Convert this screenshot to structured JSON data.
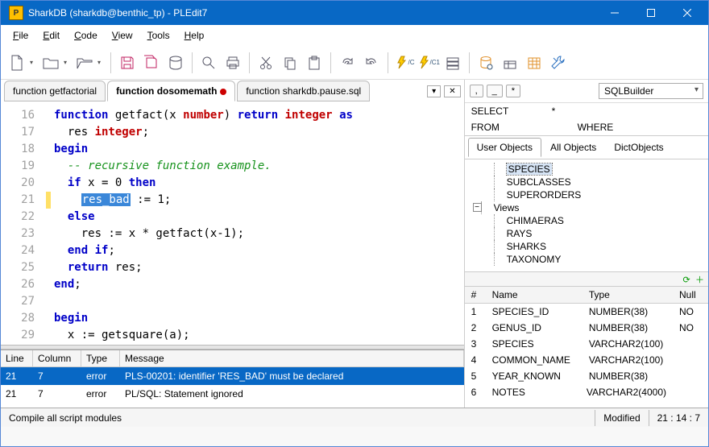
{
  "window": {
    "title": "SharkDB (sharkdb@benthic_tp) - PLEdit7"
  },
  "menu": {
    "file": "File",
    "edit": "Edit",
    "code": "Code",
    "view": "View",
    "tools": "Tools",
    "help": "Help"
  },
  "tabs": [
    {
      "label": "function getfactorial",
      "active": false
    },
    {
      "label": "function dosomemath",
      "active": true,
      "dirty": true
    },
    {
      "label": "function sharkdb.pause.sql",
      "active": false
    }
  ],
  "code_lines": [
    {
      "n": 16,
      "tokens": [
        [
          "kw",
          "function"
        ],
        [
          "id",
          " getfact(x "
        ],
        [
          "dt",
          "number"
        ],
        [
          "id",
          ") "
        ],
        [
          "kw",
          "return"
        ],
        [
          "id",
          " "
        ],
        [
          "dt",
          "integer"
        ],
        [
          "id",
          " "
        ],
        [
          "kw",
          "as"
        ]
      ]
    },
    {
      "n": 17,
      "tokens": [
        [
          "id",
          "  res "
        ],
        [
          "dt",
          "integer"
        ],
        [
          "id",
          ";"
        ]
      ]
    },
    {
      "n": 18,
      "tokens": [
        [
          "kw",
          "begin"
        ]
      ]
    },
    {
      "n": 19,
      "tokens": [
        [
          "id",
          "  "
        ],
        [
          "cm",
          "-- recursive function example."
        ]
      ]
    },
    {
      "n": 20,
      "tokens": [
        [
          "id",
          "  "
        ],
        [
          "kw",
          "if"
        ],
        [
          "id",
          " x = 0 "
        ],
        [
          "kw",
          "then"
        ]
      ]
    },
    {
      "n": 21,
      "err": true,
      "tokens": [
        [
          "id",
          "    "
        ],
        [
          "hl",
          "res_bad"
        ],
        [
          "id",
          " := 1;"
        ]
      ]
    },
    {
      "n": 22,
      "tokens": [
        [
          "id",
          "  "
        ],
        [
          "kw",
          "else"
        ]
      ]
    },
    {
      "n": 23,
      "tokens": [
        [
          "id",
          "    res := x * getfact(x-1);"
        ]
      ]
    },
    {
      "n": 24,
      "tokens": [
        [
          "id",
          "  "
        ],
        [
          "kw",
          "end"
        ],
        [
          "id",
          " "
        ],
        [
          "kw",
          "if"
        ],
        [
          "id",
          ";"
        ]
      ]
    },
    {
      "n": 25,
      "tokens": [
        [
          "id",
          "  "
        ],
        [
          "kw",
          "return"
        ],
        [
          "id",
          " res;"
        ]
      ]
    },
    {
      "n": 26,
      "tokens": [
        [
          "kw",
          "end"
        ],
        [
          "id",
          ";"
        ]
      ]
    },
    {
      "n": 27,
      "tokens": []
    },
    {
      "n": 28,
      "tokens": [
        [
          "kw",
          "begin"
        ]
      ]
    },
    {
      "n": 29,
      "tokens": [
        [
          "id",
          "  x := getsquare(a);"
        ]
      ]
    }
  ],
  "errors": {
    "headers": {
      "line": "Line",
      "col": "Column",
      "type": "Type",
      "msg": "Message"
    },
    "rows": [
      {
        "line": "21",
        "col": "7",
        "type": "error",
        "msg": "PLS-00201: identifier 'RES_BAD' must be declared",
        "sel": true
      },
      {
        "line": "21",
        "col": "7",
        "type": "error",
        "msg": "PL/SQL: Statement ignored",
        "sel": false
      }
    ]
  },
  "sql_area": {
    "builder_label": "SQLBuilder",
    "chips": [
      ",",
      "_",
      "*"
    ],
    "rows": {
      "select": "SELECT",
      "select_v": "*",
      "from": "FROM",
      "where": "WHERE"
    }
  },
  "obj_tabs": {
    "user": "User Objects",
    "all": "All Objects",
    "dict": "DictObjects"
  },
  "tree": {
    "tables": [
      {
        "name": "SPECIES",
        "sel": true
      },
      {
        "name": "SUBCLASSES"
      },
      {
        "name": "SUPERORDERS"
      }
    ],
    "views_label": "Views",
    "views": [
      {
        "name": "CHIMAERAS"
      },
      {
        "name": "RAYS"
      },
      {
        "name": "SHARKS"
      },
      {
        "name": "TAXONOMY"
      }
    ]
  },
  "columns": {
    "headers": {
      "n": "#",
      "name": "Name",
      "type": "Type",
      "null": "Null"
    },
    "rows": [
      {
        "n": "1",
        "name": "SPECIES_ID",
        "type": "NUMBER(38)",
        "null": "NO"
      },
      {
        "n": "2",
        "name": "GENUS_ID",
        "type": "NUMBER(38)",
        "null": "NO"
      },
      {
        "n": "3",
        "name": "SPECIES",
        "type": "VARCHAR2(100)",
        "null": ""
      },
      {
        "n": "4",
        "name": "COMMON_NAME",
        "type": "VARCHAR2(100)",
        "null": ""
      },
      {
        "n": "5",
        "name": "YEAR_KNOWN",
        "type": "NUMBER(38)",
        "null": ""
      },
      {
        "n": "6",
        "name": "NOTES",
        "type": "VARCHAR2(4000)",
        "null": ""
      }
    ]
  },
  "status": {
    "hint": "Compile all script modules",
    "modified": "Modified",
    "pos": "21 : 14 : 7"
  }
}
